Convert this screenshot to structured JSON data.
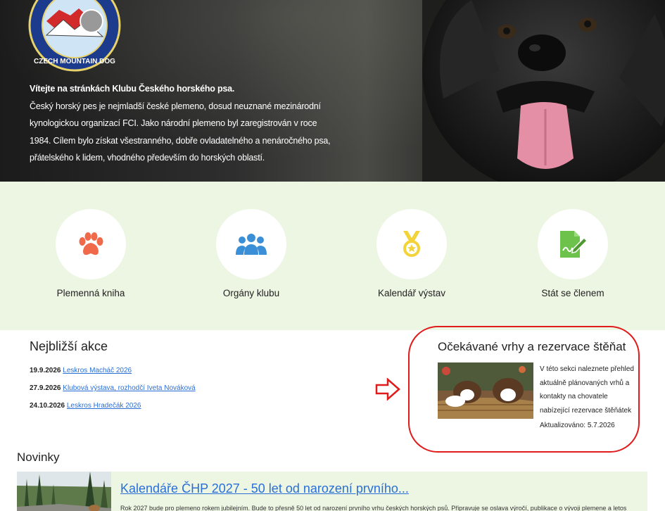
{
  "hero": {
    "logo_text": "CZECH MOUNTAIN DOG",
    "intro_lead": "Vítejte na stránkách Klubu Českého horského psa.",
    "intro_body": "Český horský pes je nejmladší české plemeno, dosud neuznané mezinárodní kynologickou organizací FCI. Jako národní plemeno byl zaregistrován v roce 1984. Cílem bylo získat všestranného, dobře ovladatelného a nenáročného psa, přátelského k lidem, vhodného především do horských oblastí."
  },
  "quick_links": [
    {
      "label": "Plemenná kniha",
      "icon": "paw-icon",
      "color": "#f0694a"
    },
    {
      "label": "Orgány klubu",
      "icon": "users-icon",
      "color": "#3b8fd6"
    },
    {
      "label": "Kalendář výstav",
      "icon": "medal-icon",
      "color": "#f2d33a"
    },
    {
      "label": "Stát se členem",
      "icon": "signature-icon",
      "color": "#6cc24a"
    }
  ],
  "events": {
    "title": "Nejbližší akce",
    "items": [
      {
        "date": "19.9.2026",
        "link": "Leskros Macháč 2026"
      },
      {
        "date": "27.9.2026",
        "link": "Klubová výstava, rozhodčí Iveta Nováková"
      },
      {
        "date": "24.10.2026",
        "link": "Leskros Hradečák 2026"
      }
    ]
  },
  "puppies": {
    "title": "Očekávané vrhy a rezervace štěňat",
    "text": "V této sekci naleznete přehled aktuálně plánovaných vrhů a kontakty na chovatele nabízející rezervace štěňátek",
    "updated": "Aktualizováno: 5.7.2026"
  },
  "news": {
    "title": "Novinky",
    "items": [
      {
        "headline": "Kalendáře ČHP 2027 - 50 let od narození prvního...",
        "excerpt": "Rok 2027 bude pro plemeno rokem jubilejním. Bude to přesně 50 let od narození prvního vrhu českých horských psů. Připravuje se oslava výročí, publikace o vývoji plemene a letos"
      }
    ]
  },
  "colors": {
    "accent_link": "#2a6fd6",
    "highlight_ring": "#e01b1b",
    "panel_bg": "#edf6e3"
  }
}
